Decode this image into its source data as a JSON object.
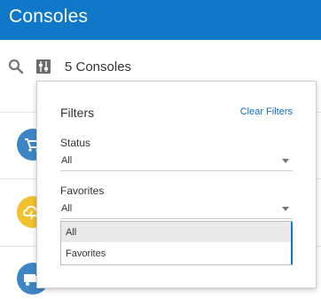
{
  "header": {
    "title": "Consoles"
  },
  "toolbar": {
    "count_label": "5 Consoles"
  },
  "list": {
    "items": [
      {
        "icon": "shopping-cart-icon",
        "color": "#3d86c6"
      },
      {
        "icon": "cloud-lightning-icon",
        "color": "#f2c12e"
      },
      {
        "icon": "truck-icon",
        "color": "#3d86c6"
      }
    ]
  },
  "filters": {
    "title": "Filters",
    "clear_label": "Clear Filters",
    "status": {
      "label": "Status",
      "value": "All"
    },
    "favorites": {
      "label": "Favorites",
      "value": "All"
    },
    "dropdown_options": [
      "All",
      "Favorites"
    ],
    "selected_option": "All"
  },
  "colors": {
    "brand": "#0f78c8",
    "link": "#0f6fb8",
    "highlight": "#e9e9e9"
  }
}
